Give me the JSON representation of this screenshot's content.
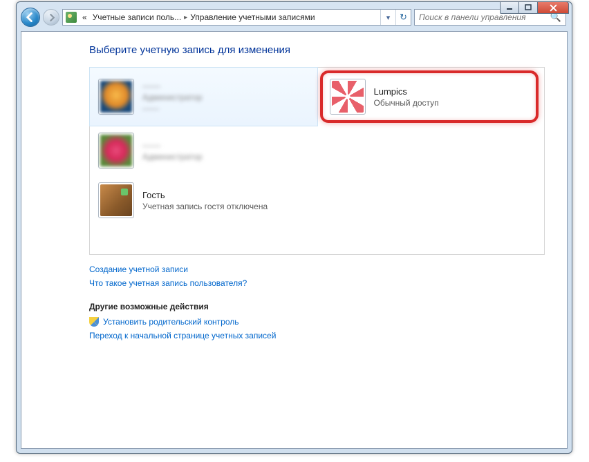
{
  "breadcrumb": {
    "prefix": "«",
    "seg1": "Учетные записи поль...",
    "seg2": "Управление учетными записями"
  },
  "search": {
    "placeholder": "Поиск в панели управления"
  },
  "heading": "Выберите учетную запись для изменения",
  "accounts": [
    {
      "name": "——",
      "type": "Администратор",
      "extra": "——"
    },
    {
      "name": "Lumpics",
      "type": "Обычный доступ"
    },
    {
      "name": "——",
      "type": "Администратор"
    },
    {
      "name": "Гость",
      "type": "Учетная запись гостя отключена"
    }
  ],
  "links": {
    "create": "Создание учетной записи",
    "what": "Что такое учетная запись пользователя?"
  },
  "other": {
    "heading": "Другие возможные действия",
    "parental": "Установить родительский контроль",
    "home": "Переход к начальной странице учетных записей"
  }
}
